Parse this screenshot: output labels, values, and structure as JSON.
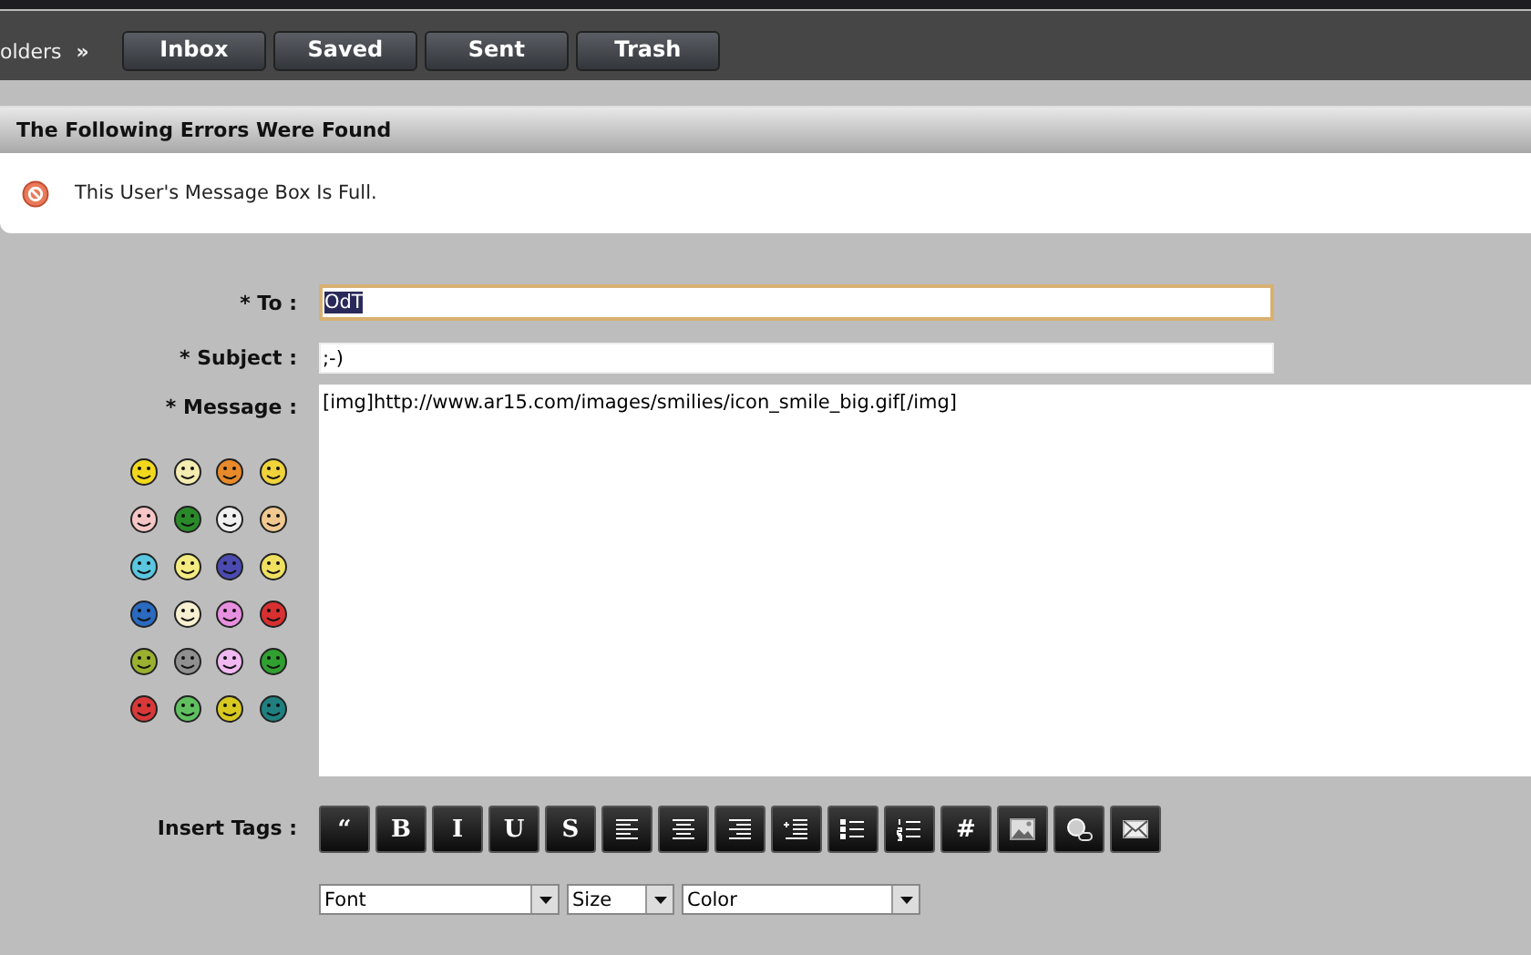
{
  "nav": {
    "breadcrumb": "olders",
    "separator": "»",
    "buttons": [
      "Inbox",
      "Saved",
      "Sent",
      "Trash"
    ]
  },
  "errors": {
    "title": "The Following Errors Were Found",
    "messages": [
      "This User's Message Box Is Full."
    ]
  },
  "form": {
    "fields": [
      {
        "label": "* To :",
        "value": "OdT",
        "focused": true
      },
      {
        "label": "* Subject :",
        "value": ";-)",
        "focused": false
      }
    ],
    "message": {
      "label": "* Message :",
      "value": "[img]http://www.ar15.com/images/smilies/icon_smile_big.gif[/img]"
    },
    "smilies": [
      {
        "color": "#f2d81c"
      },
      {
        "color": "#f4ecb0"
      },
      {
        "color": "#e88a2a"
      },
      {
        "color": "#f0d23a"
      },
      {
        "color": "#f6c6c6"
      },
      {
        "color": "#2a8a2a"
      },
      {
        "color": "#f0f0f0"
      },
      {
        "color": "#f0c890"
      },
      {
        "color": "#5ac6e0"
      },
      {
        "color": "#f4ec80"
      },
      {
        "color": "#4a4ab0"
      },
      {
        "color": "#f0e060"
      },
      {
        "color": "#2a6ac0"
      },
      {
        "color": "#f8f0d0"
      },
      {
        "color": "#e890e0"
      },
      {
        "color": "#d83030"
      },
      {
        "color": "#9ab030"
      },
      {
        "color": "#909090"
      },
      {
        "color": "#f0b8f0"
      },
      {
        "color": "#30a030"
      },
      {
        "color": "#d83838"
      },
      {
        "color": "#60c060"
      },
      {
        "color": "#d8c820"
      },
      {
        "color": "#208080"
      }
    ],
    "insert_tags": {
      "label": "Insert Tags :",
      "tools": [
        {
          "kind": "text",
          "label": "“"
        },
        {
          "kind": "text",
          "label": "B"
        },
        {
          "kind": "text",
          "label": "I"
        },
        {
          "kind": "text",
          "label": "U"
        },
        {
          "kind": "text",
          "label": "S"
        },
        {
          "kind": "align-left"
        },
        {
          "kind": "align-center"
        },
        {
          "kind": "align-right"
        },
        {
          "kind": "indent"
        },
        {
          "kind": "bullets"
        },
        {
          "kind": "numbers"
        },
        {
          "kind": "text",
          "label": "#"
        },
        {
          "kind": "image"
        },
        {
          "kind": "link"
        },
        {
          "kind": "mail"
        }
      ]
    },
    "dropdowns": [
      "Font",
      "Size",
      "Color"
    ]
  }
}
